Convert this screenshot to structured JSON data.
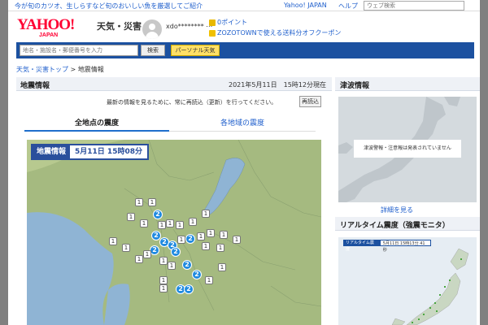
{
  "topbar": {
    "promo": "今が旬のカツオ、生しらすなど旬のおいしい魚を厳選してご紹介",
    "yahoo_japan": "Yahoo! JAPAN",
    "help": "ヘルプ",
    "web_search_placeholder": "ウェブ検索"
  },
  "header": {
    "logo": "YAHOO!",
    "logo_sub": "JAPAN",
    "site_title": "天気・災害",
    "username": "xdo********",
    "points": "0ポイント",
    "coupon": "ZOZOTOWNで使える送料分オフクーポン"
  },
  "searchbar": {
    "placeholder": "地名・施設名・郵便番号を入力",
    "search_button": "検索",
    "personal_button": "パーソナル天気"
  },
  "breadcrumb": {
    "top": "天気・災害トップ",
    "sep": " > ",
    "current": "地震情報"
  },
  "main": {
    "title": "地震情報",
    "datetime": "2021年5月11日　15時12分現在",
    "refresh_note": "最新の情報を見るために、常に再読込（更新）を行ってください。",
    "reload_button": "再読込",
    "tabs": [
      {
        "label": "全地点の震度",
        "active": true
      },
      {
        "label": "各地域の震度",
        "active": false
      }
    ],
    "map_label": "地震情報",
    "map_datetime": "5月11日 15時08分",
    "intensity_markers": [
      {
        "value": "1"
      },
      {
        "value": "1"
      },
      {
        "value": "2"
      },
      {
        "value": "1"
      },
      {
        "value": "1"
      },
      {
        "value": "2"
      },
      {
        "value": "1"
      },
      {
        "value": "1"
      },
      {
        "value": "1"
      },
      {
        "value": "1"
      },
      {
        "value": "2"
      },
      {
        "value": "2"
      },
      {
        "value": "1"
      },
      {
        "value": "2"
      },
      {
        "value": "2"
      },
      {
        "value": "1"
      },
      {
        "value": "1"
      },
      {
        "value": "1"
      },
      {
        "value": "1"
      },
      {
        "value": "1"
      },
      {
        "value": "1"
      },
      {
        "value": "2"
      },
      {
        "value": "1"
      },
      {
        "value": "1"
      },
      {
        "value": "1"
      },
      {
        "value": "1"
      },
      {
        "value": "2"
      },
      {
        "value": "1"
      },
      {
        "value": "2"
      },
      {
        "value": "1"
      },
      {
        "value": "1"
      },
      {
        "value": "1"
      },
      {
        "value": "2"
      },
      {
        "value": "2"
      },
      {
        "value": "1"
      },
      {
        "value": "1"
      },
      {
        "value": "1"
      }
    ]
  },
  "tsunami": {
    "title": "津波情報",
    "note": "津波警報・注意報は発表されていません",
    "more": "詳細を見る"
  },
  "realtime": {
    "title": "リアルタイム震度（強震モニタ）",
    "bar_label": "リアルタイム震度",
    "bar_time": "5月11日 15時13分 41秒"
  },
  "colors": {
    "brand_red": "#ff0033",
    "nav_blue": "#1c51a0",
    "link_blue": "#1f5fcc",
    "intensity2": "#1f8ae0"
  }
}
